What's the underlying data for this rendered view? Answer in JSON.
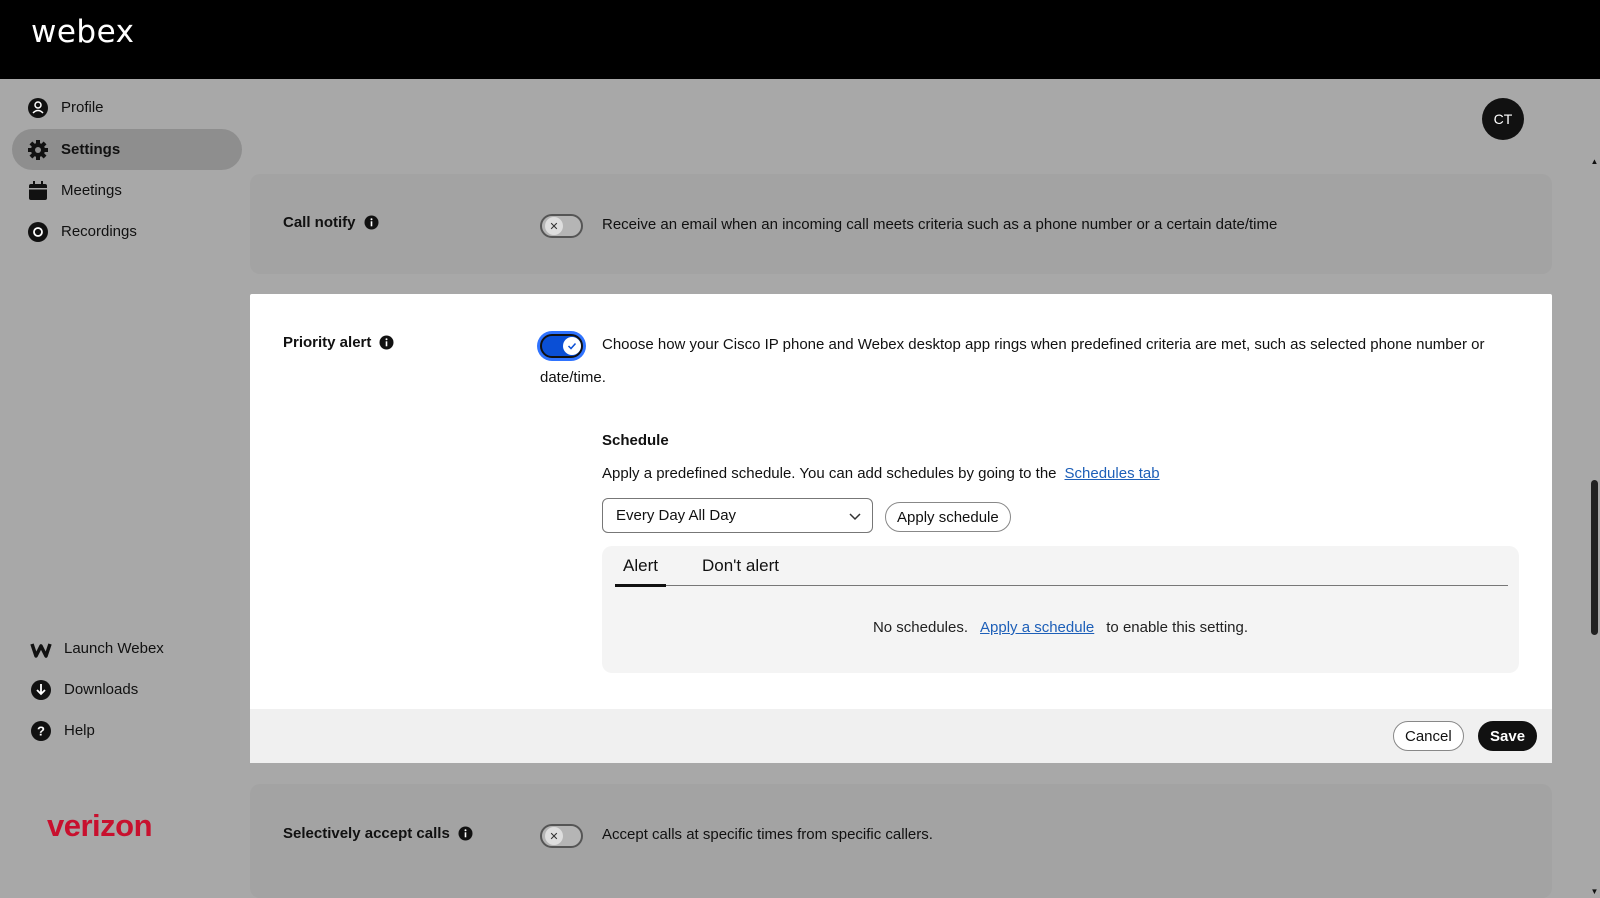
{
  "header": {
    "brand": "webex"
  },
  "sidebar": {
    "items": [
      {
        "label": "Profile",
        "icon": "profile-icon"
      },
      {
        "label": "Settings",
        "icon": "gear-icon",
        "active": true
      },
      {
        "label": "Meetings",
        "icon": "calendar-icon"
      },
      {
        "label": "Recordings",
        "icon": "record-icon"
      }
    ],
    "bottom_items": [
      {
        "label": "Launch Webex",
        "icon": "webex-logo-icon"
      },
      {
        "label": "Downloads",
        "icon": "download-icon"
      },
      {
        "label": "Help",
        "icon": "help-icon"
      }
    ],
    "partner_logo": "verizon"
  },
  "user": {
    "initials": "CT"
  },
  "call_notify": {
    "label": "Call notify",
    "enabled": false,
    "description": "Receive an email when an incoming call meets criteria such as a phone number or a certain date/time"
  },
  "priority_alert": {
    "label": "Priority alert",
    "enabled": true,
    "description_line1": "Choose how your Cisco IP phone and Webex desktop app rings when predefined criteria are met, such as selected phone number or",
    "description_line2": "date/time.",
    "schedule": {
      "title": "Schedule",
      "description": "Apply a predefined schedule. You can add schedules by going to the",
      "link": "Schedules tab",
      "selected": "Every Day All Day",
      "apply_button": "Apply schedule"
    },
    "tabs": [
      {
        "label": "Alert",
        "selected": true
      },
      {
        "label": "Don't alert",
        "selected": false
      }
    ],
    "empty": {
      "prefix": "No schedules.",
      "link": "Apply a schedule",
      "suffix": "to enable this setting."
    },
    "cancel_label": "Cancel",
    "save_label": "Save"
  },
  "selectively_accept": {
    "label": "Selectively accept calls",
    "enabled": false,
    "description": "Accept calls at specific times from specific callers."
  },
  "colors": {
    "toggle_on": "#0a4fd6",
    "link": "#1d5fb8",
    "partner": "#c8102e"
  }
}
